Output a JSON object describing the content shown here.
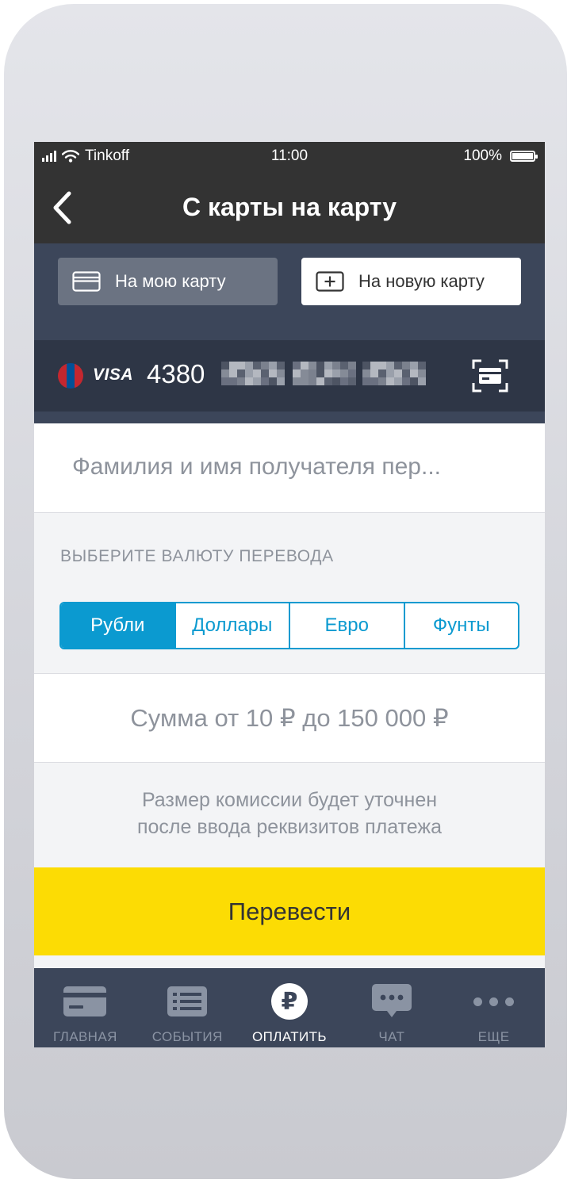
{
  "status_bar": {
    "carrier": "Tinkoff",
    "time": "11:00",
    "battery_percent": "100%",
    "battery_level": 1.0,
    "icons": [
      "signal-icon",
      "wifi-icon",
      "battery-icon"
    ]
  },
  "nav": {
    "title": "С карты на карту",
    "back_icon": "chevron-left-icon"
  },
  "destination": {
    "my_card_label": "На мою карту",
    "new_card_label": "На новую карту",
    "selected": "На новую карту"
  },
  "card": {
    "brand": "VISA",
    "number_visible": "4380",
    "flag_colors": [
      "#c4272f",
      "#015197",
      "#c4272f"
    ],
    "scan_icon": "card-scan-icon"
  },
  "recipient": {
    "placeholder": "Фамилия и имя получателя пер..."
  },
  "currency": {
    "label": "ВЫБЕРИТЕ ВАЛЮТУ ПЕРЕВОДА",
    "options": [
      "Рубли",
      "Доллары",
      "Евро",
      "Фунты"
    ],
    "selected": "Рубли"
  },
  "amount": {
    "placeholder": "Сумма от 10 ₽ до 150 000 ₽"
  },
  "commission": {
    "line1": "Размер комиссии будет уточнен",
    "line2": "после ввода реквизитов платежа"
  },
  "submit": {
    "label": "Перевести"
  },
  "tab_bar": {
    "items": [
      {
        "label": "ГЛАВНАЯ",
        "icon": "card-icon"
      },
      {
        "label": "СОБЫТИЯ",
        "icon": "list-icon"
      },
      {
        "label": "ОПЛАТИТЬ",
        "icon": "ruble-icon",
        "glyph": "₽"
      },
      {
        "label": "ЧАТ",
        "icon": "chat-bubble-icon"
      },
      {
        "label": "ЕЩЕ",
        "icon": "more-dots-icon"
      }
    ],
    "active": "ОПЛАТИТЬ"
  },
  "colors": {
    "accent": "#0b9ad0",
    "submit": "#fcdc04",
    "header": "#333333",
    "panel": "#3c465a"
  }
}
